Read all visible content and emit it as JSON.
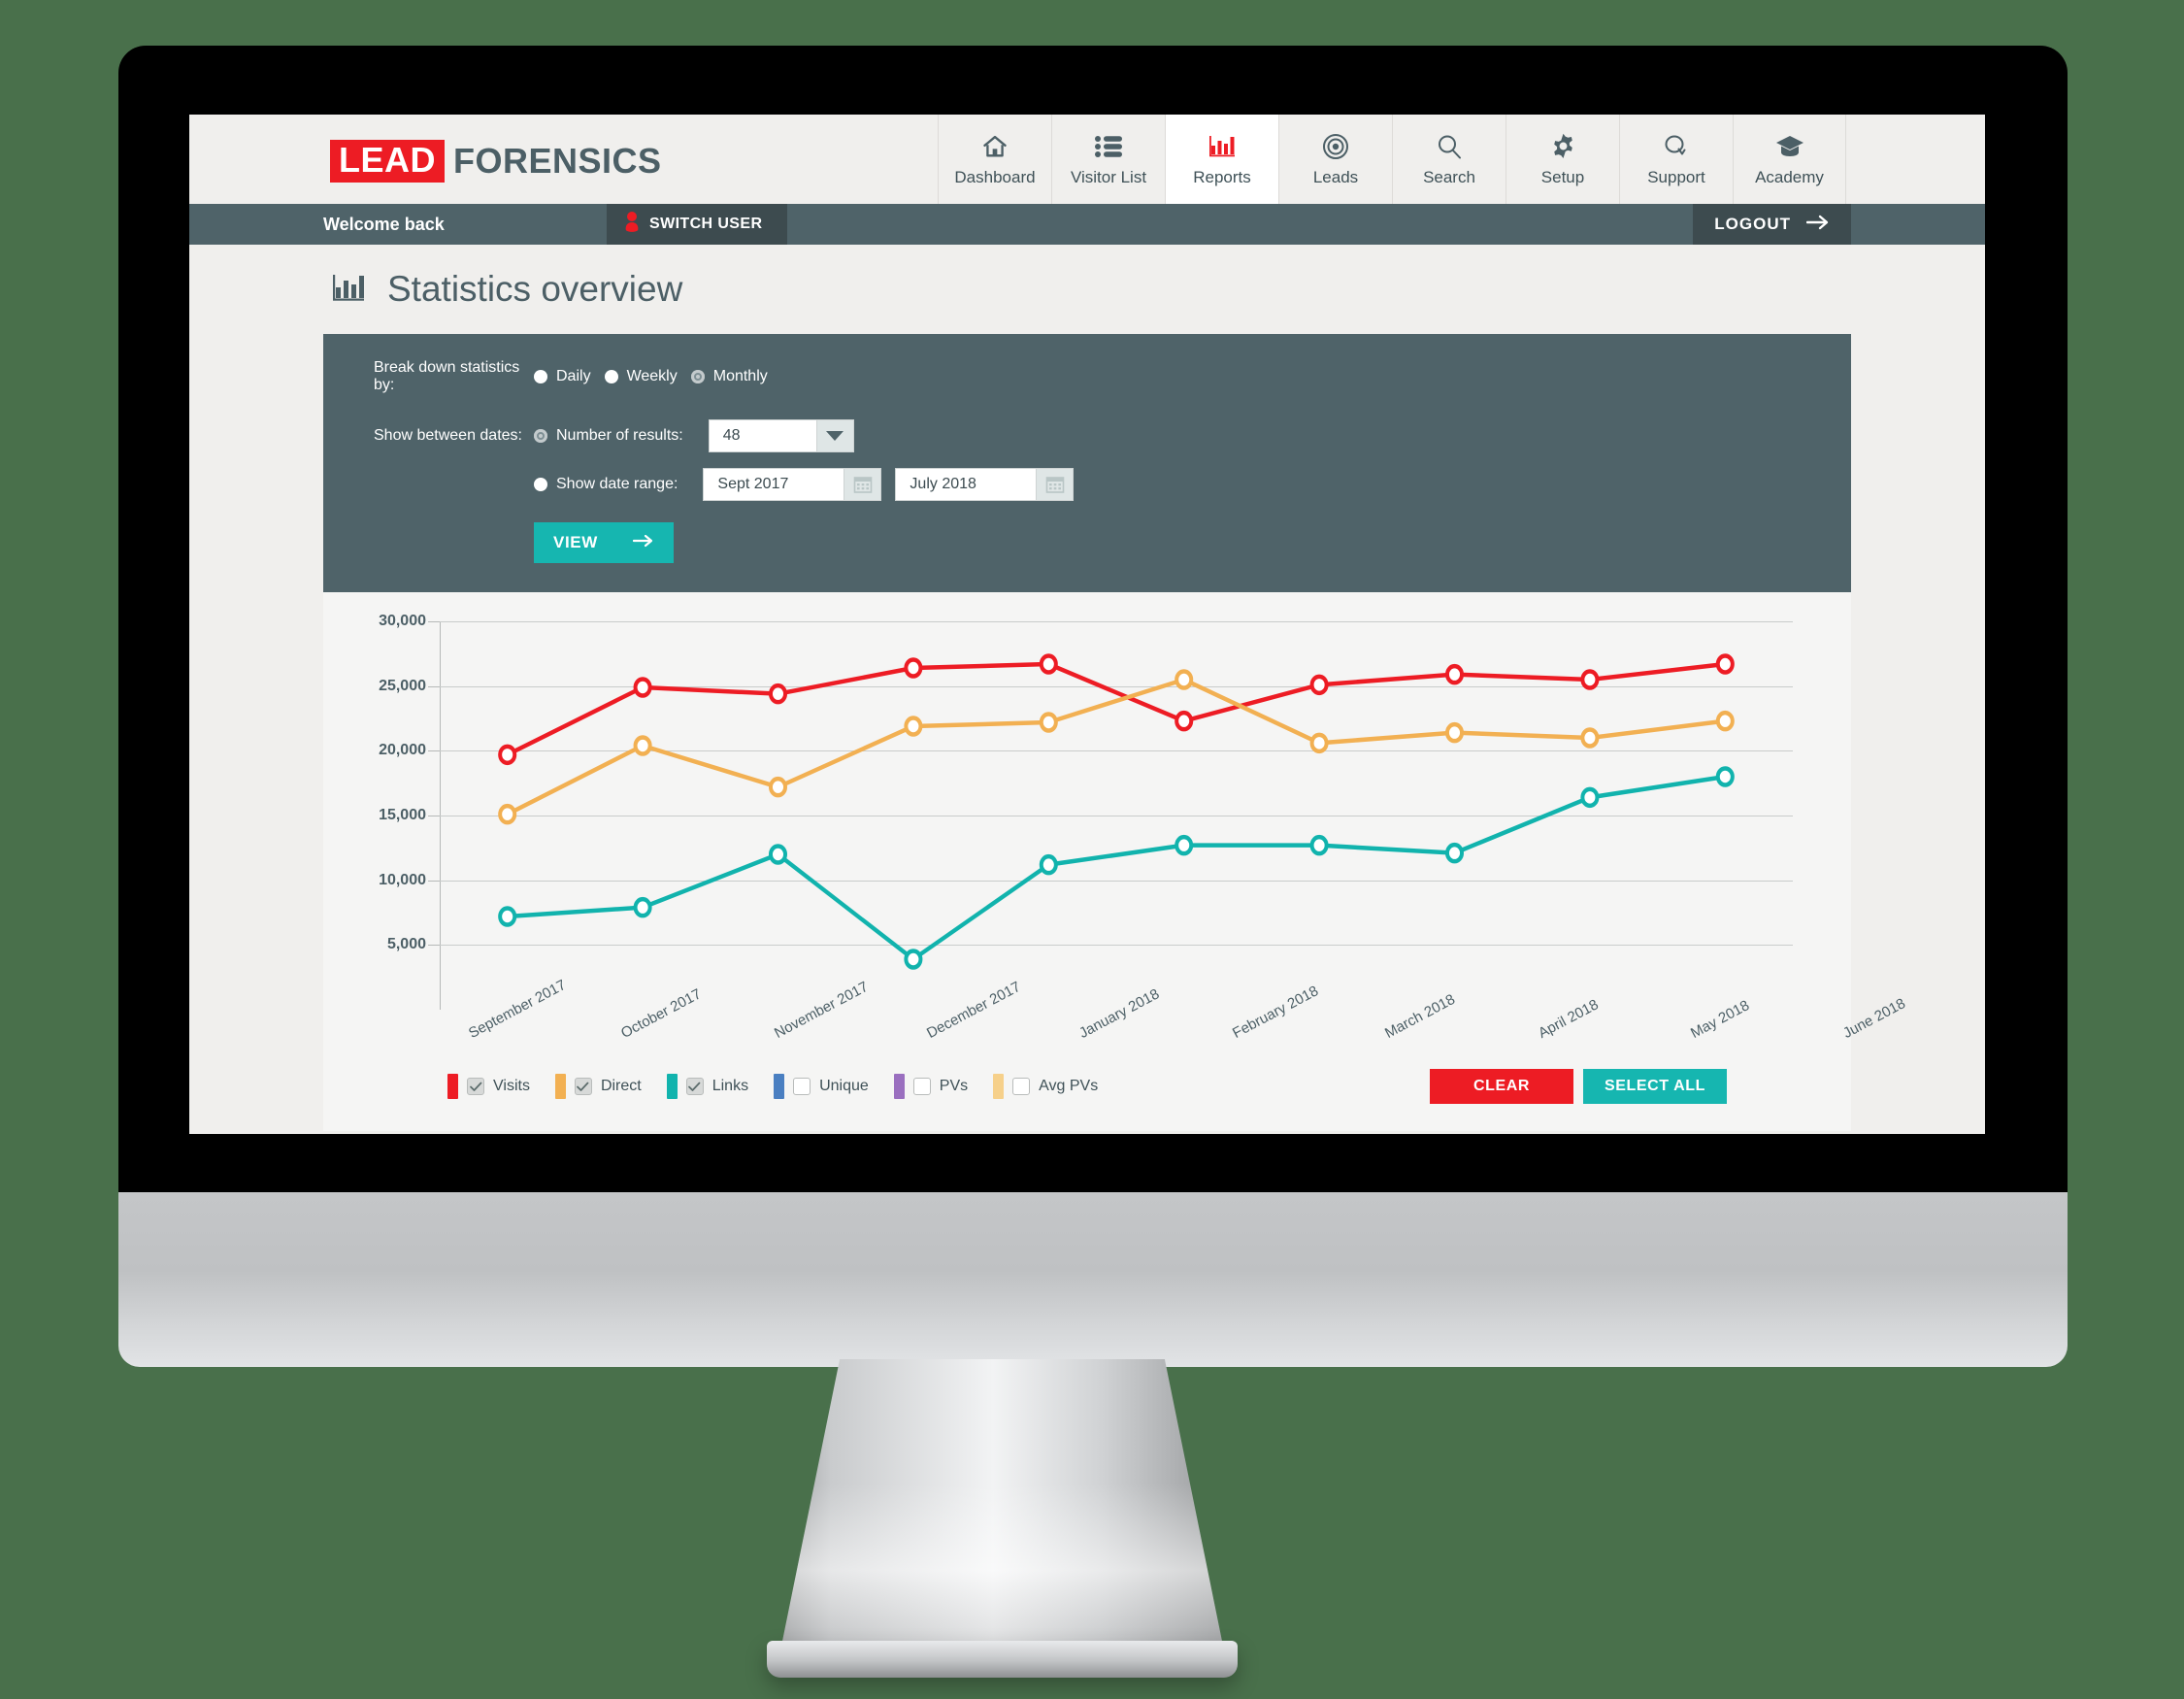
{
  "brand": {
    "lead": "LEAD",
    "forensics": "FORENSICS"
  },
  "nav": {
    "items": [
      {
        "label": "Dashboard",
        "icon": "home-icon",
        "active": false
      },
      {
        "label": "Visitor List",
        "icon": "list-icon",
        "active": false
      },
      {
        "label": "Reports",
        "icon": "bar-chart-icon",
        "active": true
      },
      {
        "label": "Leads",
        "icon": "target-icon",
        "active": false
      },
      {
        "label": "Search",
        "icon": "search-icon",
        "active": false
      },
      {
        "label": "Setup",
        "icon": "gear-icon",
        "active": false
      },
      {
        "label": "Support",
        "icon": "chat-icon",
        "active": false
      },
      {
        "label": "Academy",
        "icon": "graduation-cap-icon",
        "active": false
      }
    ]
  },
  "welcome": {
    "text": "Welcome back",
    "switch_user": "SWITCH USER",
    "logout": "LOGOUT"
  },
  "page": {
    "title": "Statistics overview",
    "icon": "bar-chart-icon"
  },
  "filters": {
    "breakdown_label": "Break down statistics by:",
    "breakdown_options": [
      {
        "label": "Daily",
        "selected": false
      },
      {
        "label": "Weekly",
        "selected": false
      },
      {
        "label": "Monthly",
        "selected": true
      }
    ],
    "dates_label": "Show between dates:",
    "number_of_results": {
      "radio_label": "Number of results:",
      "selected": true,
      "value": "48"
    },
    "date_range": {
      "radio_label": "Show date range:",
      "selected": false,
      "from": "Sept 2017",
      "to": "July 2018"
    },
    "view_button": "VIEW"
  },
  "legend": {
    "items": [
      {
        "label": "Visits",
        "color": "#ed1c24",
        "checked": true
      },
      {
        "label": "Direct",
        "color": "#f2b052",
        "checked": true
      },
      {
        "label": "Links",
        "color": "#11b3ad",
        "checked": true
      },
      {
        "label": "Unique",
        "color": "#4a7fc1",
        "checked": false
      },
      {
        "label": "PVs",
        "color": "#9a6fbf",
        "checked": false
      },
      {
        "label": "Avg PVs",
        "color": "#f6d08a",
        "checked": false
      }
    ],
    "clear_button": "CLEAR",
    "select_all_button": "SELECT ALL"
  },
  "chart_data": {
    "type": "line",
    "title": "Statistics overview",
    "xlabel": "",
    "ylabel": "",
    "ylim": [
      0,
      30000
    ],
    "yticks": [
      5000,
      10000,
      15000,
      20000,
      25000,
      30000
    ],
    "ytick_labels": [
      "5,000",
      "10,000",
      "15,000",
      "20,000",
      "25,000",
      "30,000"
    ],
    "grid": true,
    "legend_position": "bottom",
    "categories": [
      "September 2017",
      "October 2017",
      "November 2017",
      "December 2017",
      "January 2018",
      "February 2018",
      "March 2018",
      "April 2018",
      "May 2018",
      "June 2018"
    ],
    "series": [
      {
        "name": "Visits",
        "color": "#ed1c24",
        "visible": true,
        "values": [
          19700,
          24900,
          24400,
          26400,
          26700,
          22300,
          25100,
          25900,
          25500,
          26700
        ]
      },
      {
        "name": "Direct",
        "color": "#f2b052",
        "visible": true,
        "values": [
          15100,
          20400,
          17200,
          21900,
          22200,
          25500,
          20600,
          21400,
          21000,
          22300
        ]
      },
      {
        "name": "Links",
        "color": "#11b3ad",
        "visible": true,
        "values": [
          7200,
          7900,
          12000,
          3900,
          11200,
          12700,
          12700,
          12100,
          16400,
          18000
        ]
      },
      {
        "name": "Unique",
        "color": "#4a7fc1",
        "visible": false,
        "values": []
      },
      {
        "name": "PVs",
        "color": "#9a6fbf",
        "visible": false,
        "values": []
      },
      {
        "name": "Avg PVs",
        "color": "#f6d08a",
        "visible": false,
        "values": []
      }
    ]
  }
}
